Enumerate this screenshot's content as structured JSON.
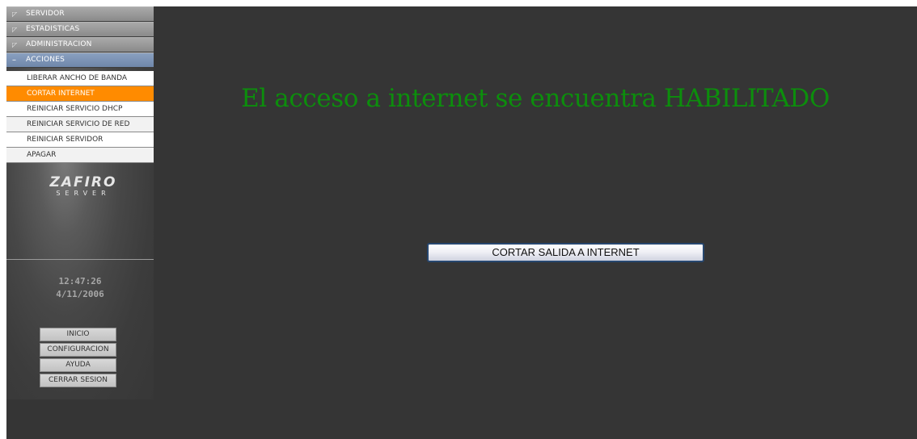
{
  "sidebar": {
    "menu": [
      {
        "label": "SERVIDOR",
        "icon": "triangle-icon"
      },
      {
        "label": "ESTADISTICAS",
        "icon": "triangle-icon"
      },
      {
        "label": "ADMINISTRACION",
        "icon": "triangle-icon"
      },
      {
        "label": "ACCIONES",
        "icon": "minus-icon"
      }
    ],
    "actions": [
      {
        "label": "LIBERAR ANCHO DE BANDA"
      },
      {
        "label": "CORTAR INTERNET",
        "active": true
      },
      {
        "label": "REINICIAR SERVICIO DHCP"
      },
      {
        "label": "REINICIAR SERVICIO DE RED"
      },
      {
        "label": "REINICIAR SERVIDOR"
      },
      {
        "label": "APAGAR"
      }
    ],
    "logo": {
      "line1": "ZAFIRO",
      "line2": "SERVER"
    },
    "clock": {
      "time": "12:47:26",
      "date": "4/11/2006"
    },
    "nav": [
      {
        "label": "INICIO"
      },
      {
        "label": "CONFIGURACION"
      },
      {
        "label": "AYUDA"
      },
      {
        "label": "CERRAR SESION"
      }
    ]
  },
  "main": {
    "status_message": "El acceso a internet se encuentra HABILITADO",
    "action_button": "CORTAR SALIDA A INTERNET"
  },
  "colors": {
    "active_item": "#ff8b00",
    "status_text": "#0c8e0c",
    "open_menu": "#7a90b3",
    "background": "#353535"
  }
}
